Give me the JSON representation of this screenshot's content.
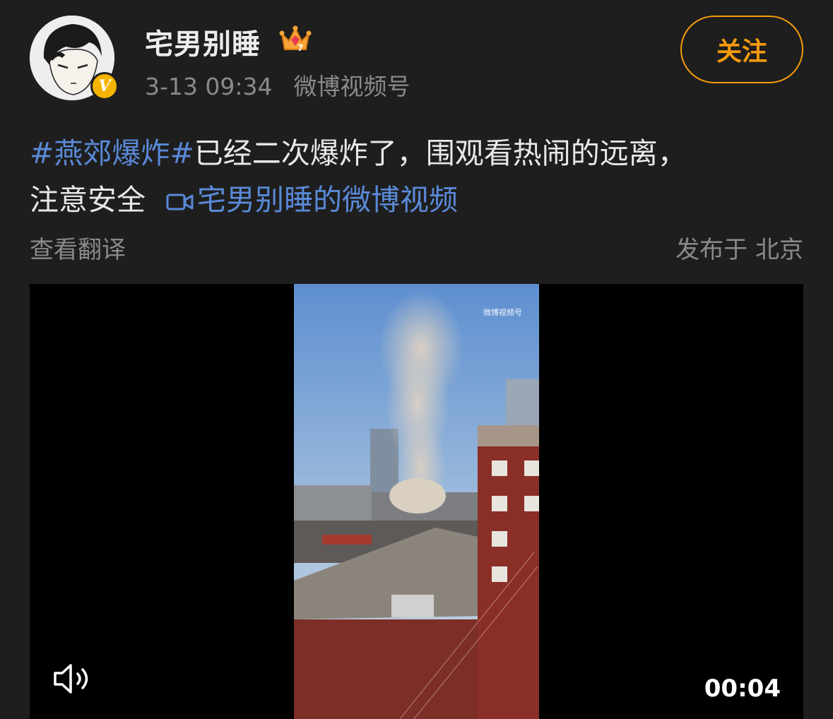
{
  "author": {
    "name": "宅男别睡",
    "avatar_icon": "anime-avatar",
    "badge_icon": "verified-v-icon",
    "badge_label": "V",
    "crown_icon": "crown-icon"
  },
  "meta": {
    "time": "3-13 09:34",
    "source": "微博视频号"
  },
  "follow_button": {
    "label": "关注"
  },
  "post": {
    "topic": "#燕郊爆炸#",
    "text_line1": "已经二次爆炸了，围观看热闹的远离，",
    "text_line2": "注意安全",
    "video_link_label": "宅男别睡的微博视频",
    "video_link_icon": "video-camera-icon"
  },
  "translate_label": "查看翻译",
  "location_label": "发布于 北京",
  "video": {
    "watermark": "微博视频号",
    "duration": "00:04",
    "mute_icon": "speaker-icon"
  },
  "colors": {
    "background": "#1e1e1e",
    "link_blue": "#5a8ad8",
    "follow_orange": "#f59a0c",
    "muted_text": "#8a8a8a",
    "verified_gold": "#f5b400"
  }
}
